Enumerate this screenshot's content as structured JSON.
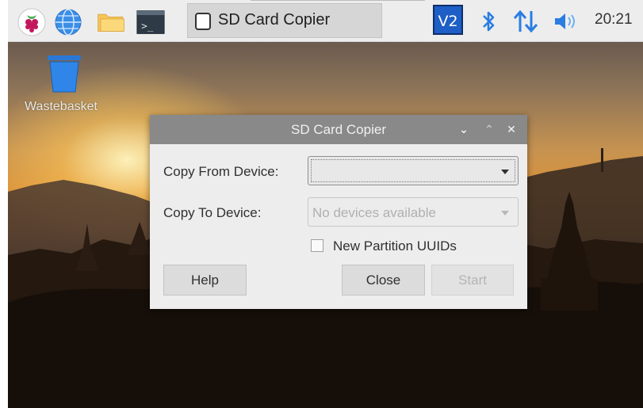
{
  "taskbar": {
    "launchers": [
      {
        "icon": "raspberry-menu-icon"
      },
      {
        "icon": "web-browser-globe-icon"
      },
      {
        "icon": "file-manager-folder-icon"
      },
      {
        "icon": "terminal-icon"
      }
    ],
    "task": {
      "label": "SD Card Copier",
      "icon": "document-window-icon"
    },
    "tray": {
      "vnc": "VNC",
      "vnc_text": "V2",
      "bluetooth": "bluetooth-icon",
      "network": "network-updown-icon",
      "volume": "volume-icon"
    },
    "clock": "20:21"
  },
  "desktop": {
    "wastebasket_label": "Wastebasket"
  },
  "dialog": {
    "title": "SD Card Copier",
    "controls": {
      "minimize": "⌄",
      "maximize": "⌃",
      "close": "✕"
    },
    "copy_from_label": "Copy From Device:",
    "copy_from_value": "",
    "copy_to_label": "Copy To Device:",
    "copy_to_value": "No devices available",
    "uuid_label": "New Partition UUIDs",
    "uuid_checked": false,
    "buttons": {
      "help": "Help",
      "close": "Close",
      "start": "Start"
    }
  },
  "colors": {
    "panel": "#ededed",
    "titlebar": "#898989",
    "vnc_bg": "#1d5ec7",
    "tray_blue": "#2a7de1"
  }
}
